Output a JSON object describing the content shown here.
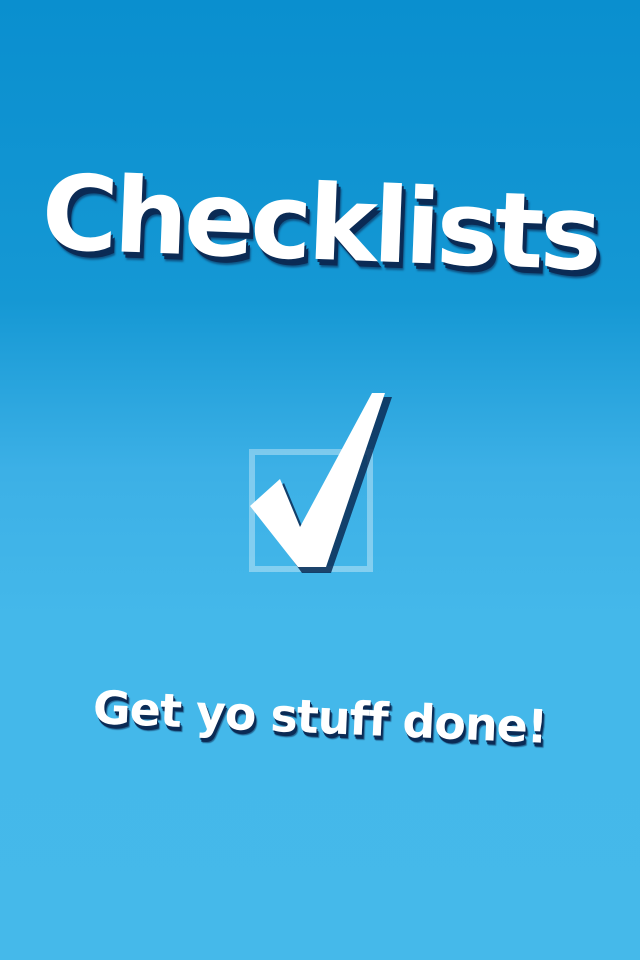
{
  "splash": {
    "title": "Checklists",
    "tagline": "Get yo stuff done!",
    "icon": "checkmark-in-box-icon",
    "colors": {
      "background_top": "#0a8fcf",
      "background_bottom": "#45b9ea",
      "text": "#ffffff",
      "text_shadow": "#0b2b55"
    }
  }
}
